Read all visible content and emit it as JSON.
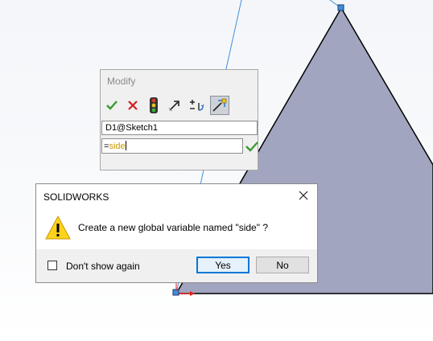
{
  "modify_dialog": {
    "title": "Modify",
    "toolbar": [
      {
        "icon": "checkmark-icon",
        "label": "OK"
      },
      {
        "icon": "x-cancel-icon",
        "label": "Cancel"
      },
      {
        "icon": "traffic-light-icon",
        "label": "Rebuild"
      },
      {
        "icon": "arrow-icon",
        "label": "Reset spin increment"
      },
      {
        "icon": "plus-minus-spin-icon",
        "label": "Mark dimension"
      },
      {
        "icon": "dimension-marker-icon",
        "label": "Mark for drawing"
      }
    ],
    "dimension_name": "D1@Sketch1",
    "value_prefix": "=",
    "value_variable": "side"
  },
  "message_box": {
    "title": "SOLIDWORKS",
    "message": "Create a new global variable named \"side\" ?",
    "checkbox_label": "Don't show again",
    "checkbox_checked": false,
    "yes_label": "Yes",
    "no_label": "No"
  },
  "colors": {
    "triangle_fill": "#a2a5bf",
    "construction_line": "#3f8fde",
    "primary_button_border": "#0078d7",
    "variable_text": "#c89a00",
    "ok_green": "#3a9a32",
    "cancel_red": "#d22020"
  }
}
